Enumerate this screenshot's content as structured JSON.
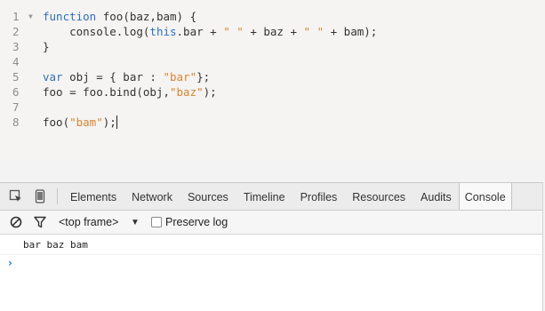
{
  "editor": {
    "lines": [
      {
        "num": "1",
        "folded": true,
        "tokens": [
          {
            "t": "function",
            "c": "kw"
          },
          {
            "t": " foo(baz,bam) {",
            "c": ""
          }
        ]
      },
      {
        "num": "2",
        "tokens": [
          {
            "t": "    console.log(",
            "c": ""
          },
          {
            "t": "this",
            "c": "kw"
          },
          {
            "t": ".bar + ",
            "c": ""
          },
          {
            "t": "\" \"",
            "c": "str"
          },
          {
            "t": " + baz + ",
            "c": ""
          },
          {
            "t": "\" \"",
            "c": "str"
          },
          {
            "t": " + bam);",
            "c": ""
          }
        ]
      },
      {
        "num": "3",
        "tokens": [
          {
            "t": "}",
            "c": ""
          }
        ]
      },
      {
        "num": "4",
        "tokens": []
      },
      {
        "num": "5",
        "tokens": [
          {
            "t": "var",
            "c": "kw"
          },
          {
            "t": " obj = { bar : ",
            "c": ""
          },
          {
            "t": "\"bar\"",
            "c": "str"
          },
          {
            "t": "};",
            "c": ""
          }
        ]
      },
      {
        "num": "6",
        "tokens": [
          {
            "t": "foo = foo.bind(obj,",
            "c": ""
          },
          {
            "t": "\"baz\"",
            "c": "str"
          },
          {
            "t": ");",
            "c": ""
          }
        ]
      },
      {
        "num": "7",
        "tokens": []
      },
      {
        "num": "8",
        "cursor": true,
        "tokens": [
          {
            "t": "foo(",
            "c": ""
          },
          {
            "t": "\"bam\"",
            "c": "str"
          },
          {
            "t": ");",
            "c": ""
          }
        ]
      }
    ]
  },
  "devtools": {
    "tabs": [
      {
        "id": "elements",
        "label": "Elements"
      },
      {
        "id": "network",
        "label": "Network"
      },
      {
        "id": "sources",
        "label": "Sources"
      },
      {
        "id": "timeline",
        "label": "Timeline"
      },
      {
        "id": "profiles",
        "label": "Profiles"
      },
      {
        "id": "resources",
        "label": "Resources"
      },
      {
        "id": "audits",
        "label": "Audits"
      },
      {
        "id": "console",
        "label": "Console",
        "active": true
      }
    ],
    "toolbar": {
      "frame_label": "<top frame>",
      "preserve_log_label": "Preserve log",
      "preserve_log_checked": false
    },
    "console": {
      "output": "bar baz bam",
      "prompt_symbol": "›"
    },
    "icons": {
      "inspect": "inspect-element-icon",
      "device": "device-mode-icon",
      "clear": "clear-console-icon",
      "filter": "filter-icon"
    },
    "colors": {
      "keyword": "#2f6fc1",
      "string": "#e08430",
      "prompt": "#2f7bd9"
    }
  }
}
